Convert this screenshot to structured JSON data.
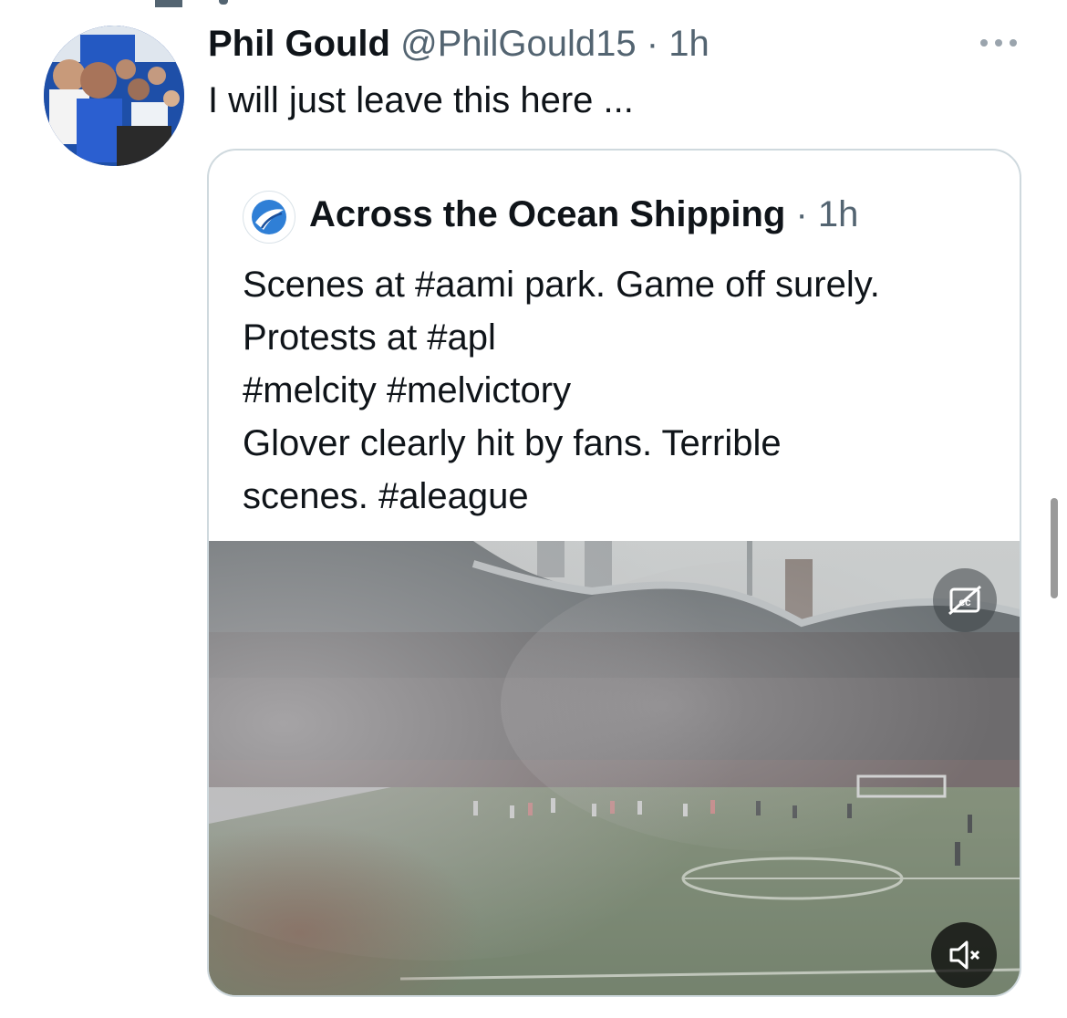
{
  "tweet": {
    "author_name": "Phil Gould",
    "author_handle": "@PhilGould15",
    "separator": "·",
    "time": "1h",
    "text": "I will just leave this here ...",
    "more_icon": "more-horizontal-icon"
  },
  "quoted_tweet": {
    "author_name": "Across the Ocean Shipping",
    "separator": "·",
    "time": "1h",
    "text_lines": [
      "Scenes at #aami park. Game off surely.",
      "Protests at #apl",
      "#melcity #melvictory",
      "Glover clearly hit by fans. Terrible",
      "scenes. #aleague"
    ],
    "media": {
      "type": "video",
      "captions_icon": "captions-off-icon",
      "mute_icon": "volume-muted-icon"
    }
  },
  "colors": {
    "text_primary": "#0f1419",
    "text_secondary": "#536471",
    "card_border": "#cfd9de"
  }
}
